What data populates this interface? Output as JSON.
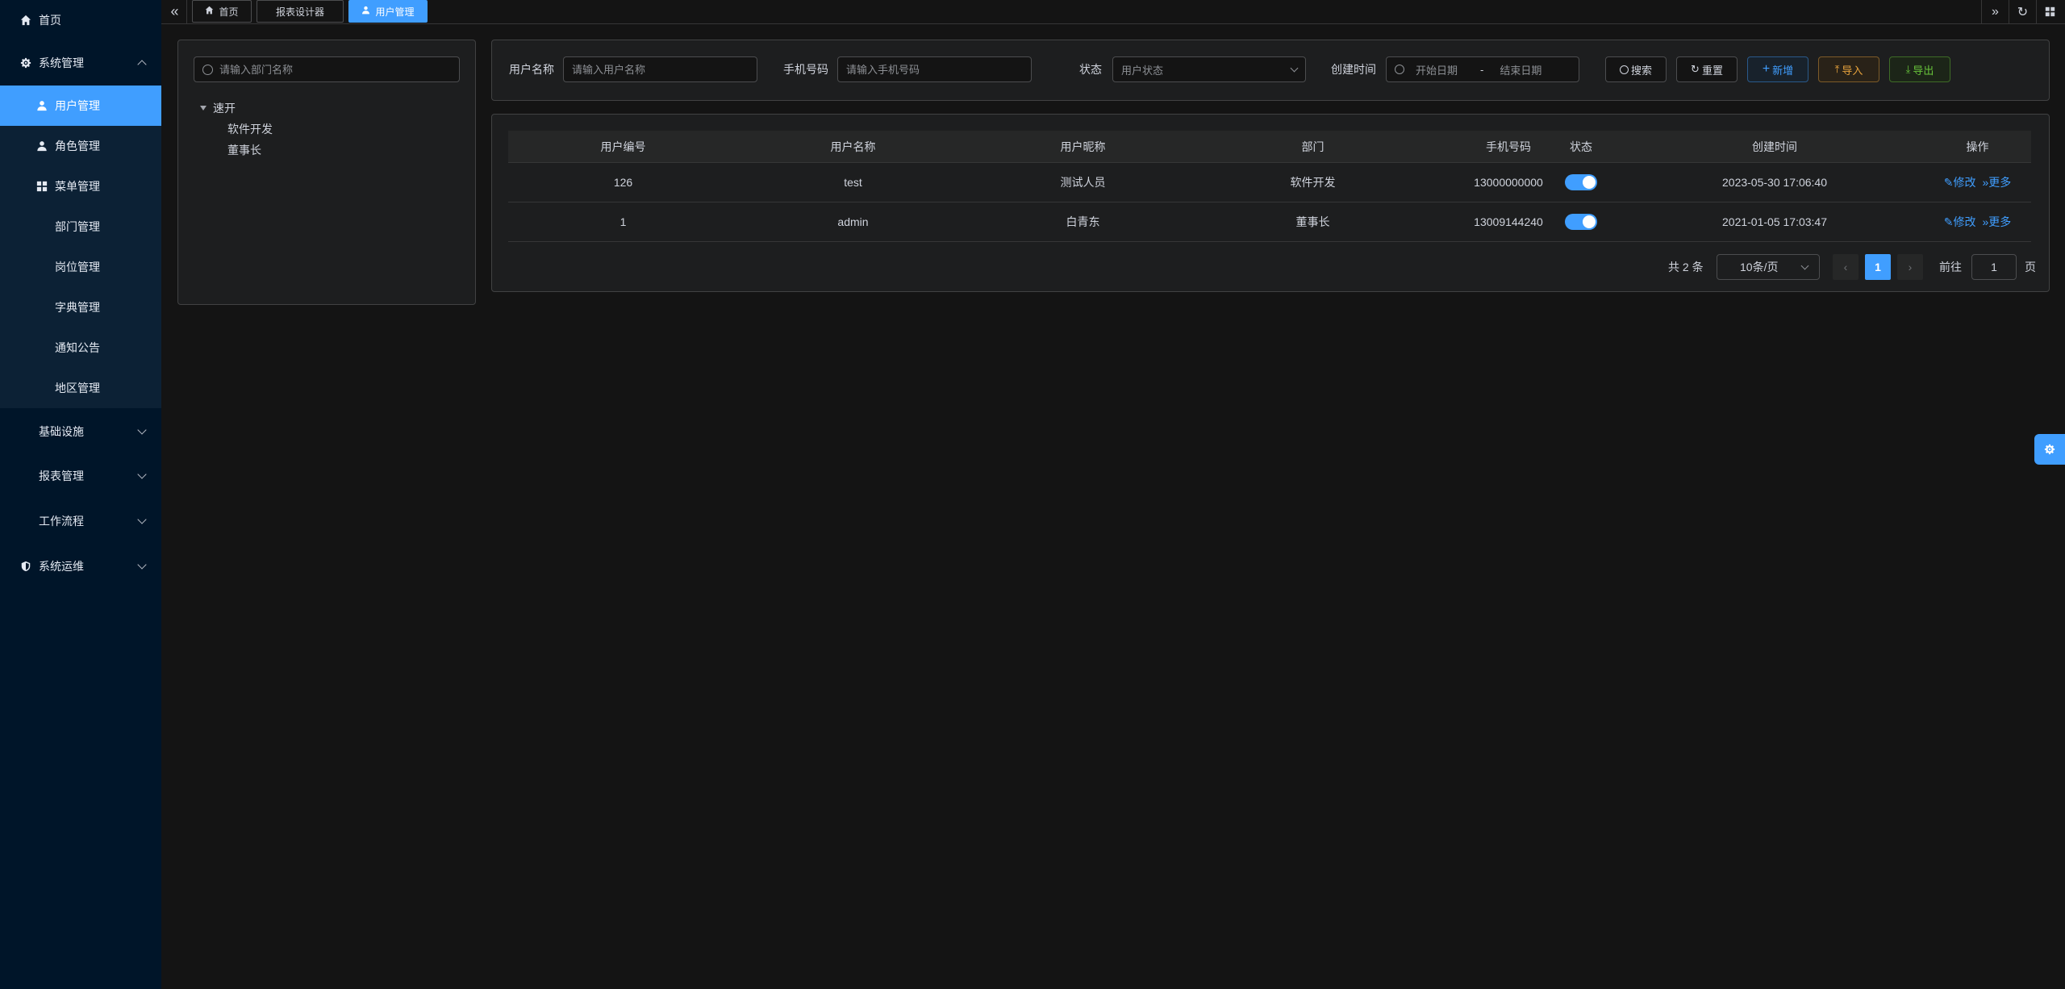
{
  "sidebar": {
    "home": "首页",
    "system": "系统管理",
    "sub": {
      "user": "用户管理",
      "role": "角色管理",
      "menu": "菜单管理",
      "dept": "部门管理",
      "post": "岗位管理",
      "dict": "字典管理",
      "notice": "通知公告",
      "region": "地区管理"
    },
    "infra": "基础设施",
    "report": "报表管理",
    "workflow": "工作流程",
    "ops": "系统运维"
  },
  "tabs": {
    "home": "首页",
    "report_designer": "报表设计器",
    "user_mgmt": "用户管理"
  },
  "tree": {
    "search_placeholder": "请输入部门名称",
    "root": "速开",
    "children": [
      "软件开发",
      "董事长"
    ]
  },
  "filters": {
    "username_label": "用户名称",
    "username_placeholder": "请输入用户名称",
    "phone_label": "手机号码",
    "phone_placeholder": "请输入手机号码",
    "status_label": "状态",
    "status_placeholder": "用户状态",
    "created_label": "创建时间",
    "start_placeholder": "开始日期",
    "range_sep": "-",
    "end_placeholder": "结束日期"
  },
  "buttons": {
    "search": "搜索",
    "reset": "重置",
    "add": "新增",
    "import": "导入",
    "export": "导出"
  },
  "table": {
    "columns": [
      "用户编号",
      "用户名称",
      "用户昵称",
      "部门",
      "手机号码",
      "状态",
      "创建时间",
      "操作"
    ],
    "rows": [
      {
        "id": "126",
        "username": "test",
        "nickname": "测试人员",
        "dept": "软件开发",
        "phone": "13000000000",
        "status_on": true,
        "created": "2023-05-30 17:06:40",
        "edit": "修改",
        "more": "更多"
      },
      {
        "id": "1",
        "username": "admin",
        "nickname": "白青东",
        "dept": "董事长",
        "phone": "13009144240",
        "status_on": true,
        "created": "2021-01-05 17:03:47",
        "edit": "修改",
        "more": "更多"
      }
    ]
  },
  "pagination": {
    "total": "共 2 条",
    "page_size": "10条/页",
    "current_page": "1",
    "goto_label": "前往",
    "goto_value": "1",
    "page_suffix": "页"
  },
  "colors": {
    "accent": "#409eff",
    "sidebar_bg": "#001529",
    "page_bg": "#141414"
  }
}
